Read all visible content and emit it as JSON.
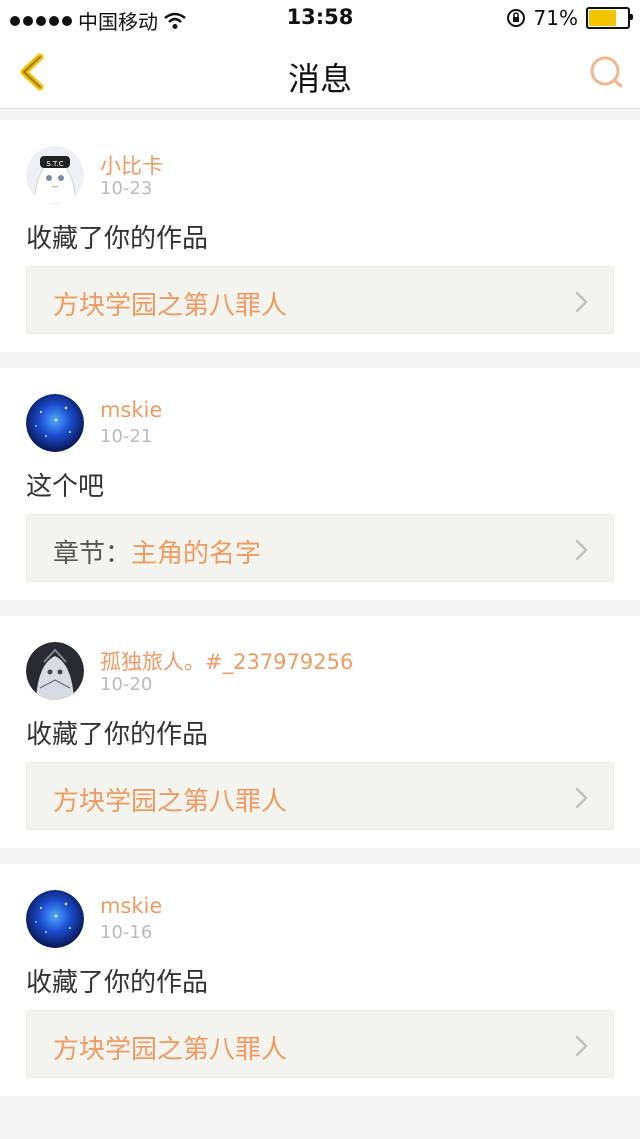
{
  "status_bar": {
    "carrier": "中国移动",
    "time": "13:58",
    "battery": "71%",
    "battery_level": 0.71
  },
  "nav": {
    "title": "消息"
  },
  "colors": {
    "accent": "#ef9a62",
    "nav_icon": "#f0c000"
  },
  "messages": [
    {
      "user": "小比卡",
      "date": "10-23",
      "text": "收藏了你的作品",
      "link_prefix": "",
      "link": "方块学园之第八罪人",
      "avatar": "anime-girl-avatar"
    },
    {
      "user": "mskie",
      "date": "10-21",
      "text": "这个吧",
      "link_prefix": "章节：",
      "link": "主角的名字",
      "avatar": "galaxy-avatar"
    },
    {
      "user": "孤独旅人。#_237979256",
      "date": "10-20",
      "text": "收藏了你的作品",
      "link_prefix": "",
      "link": "方块学园之第八罪人",
      "avatar": "dark-anime-avatar"
    },
    {
      "user": "mskie",
      "date": "10-16",
      "text": "收藏了你的作品",
      "link_prefix": "",
      "link": "方块学园之第八罪人",
      "avatar": "galaxy-avatar"
    }
  ]
}
